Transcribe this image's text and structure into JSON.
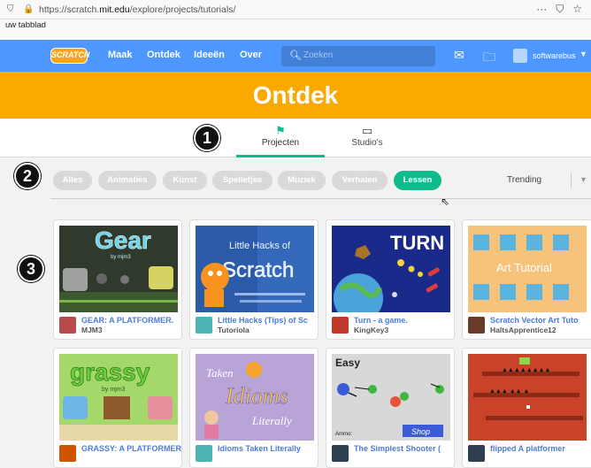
{
  "browser": {
    "url_prefix": "https://scratch.",
    "url_domain": "mit.edu",
    "url_path": "/explore/projects/tutorials/",
    "menu_icon": "···",
    "pocket_icon": "pocket-icon",
    "star_icon": "star-icon",
    "bookmark": "uw tabblad"
  },
  "nav": {
    "logo": "SCRATCH",
    "links": [
      "Maak",
      "Ontdek",
      "Ideeën",
      "Over"
    ],
    "search_placeholder": "Zoeken",
    "username": "softwarebus"
  },
  "banner": {
    "title": "Ontdek"
  },
  "tabs": [
    {
      "label": "Projecten",
      "icon": "flag-icon",
      "active": true
    },
    {
      "label": "Studio's",
      "icon": "studio-icon",
      "active": false
    }
  ],
  "badges": [
    "1",
    "2",
    "3"
  ],
  "filters": [
    "Alles",
    "Animaties",
    "Kunst",
    "Spelletjes",
    "Muziek",
    "Verhalen",
    "Lessen"
  ],
  "active_filter": "Lessen",
  "sort": {
    "label": "Trending"
  },
  "projects": [
    {
      "title": "GEAR: A PLATFORMER.",
      "author": "MJM3"
    },
    {
      "title": "Little Hacks (Tips) of Sc",
      "author": "Tutoriola"
    },
    {
      "title": "Turn - a game.",
      "author": "KingKey3"
    },
    {
      "title": "Scratch Vector Art Tuto",
      "author": "HaltsApprentice12"
    },
    {
      "title": "GRASSY: A PLATFORMER",
      "author": ""
    },
    {
      "title": "Idioms Taken Literally",
      "author": ""
    },
    {
      "title": "The Simplest Shooter (",
      "author": ""
    },
    {
      "title": "flipped A platformer",
      "author": ""
    }
  ],
  "thumb_text": {
    "gear": "Gear",
    "gear_by": "by mjm3",
    "hacks_line1": "Little Hacks of",
    "hacks_line2": "Scratch",
    "turn": "TURN",
    "art": "Art Tutorial",
    "grassy": "grassy",
    "grassy_by": "by mjm3",
    "idioms_taken": "Taken",
    "idioms": "Idioms",
    "idioms_literally": "Literally",
    "easy": "Easy",
    "ammo": "Ammo:",
    "shop": "Shop"
  },
  "colors": {
    "scratch_blue": "#4d97ff",
    "banner_orange": "#f9a900",
    "active_green": "#0fbd8c",
    "link_blue": "#4d7bd8"
  }
}
